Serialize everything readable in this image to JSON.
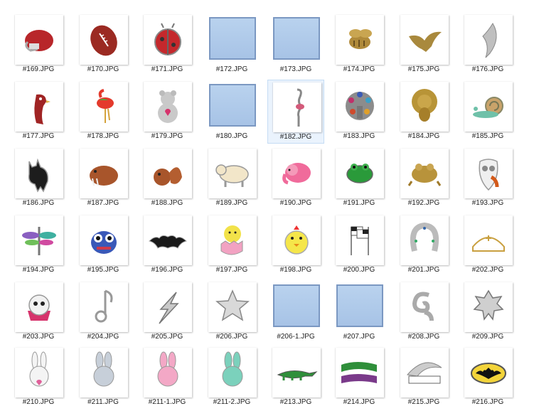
{
  "tiles": [
    {
      "label": "#169.JPG",
      "icon": "football-helmet-icon",
      "kind": "photo"
    },
    {
      "label": "#170.JPG",
      "icon": "football-icon",
      "kind": "photo"
    },
    {
      "label": "#171.JPG",
      "icon": "ladybug-icon",
      "kind": "photo"
    },
    {
      "label": "#172.JPG",
      "icon": "image-placeholder-icon",
      "kind": "placeholder"
    },
    {
      "label": "#173.JPG",
      "icon": "image-placeholder-icon",
      "kind": "placeholder"
    },
    {
      "label": "#174.JPG",
      "icon": "bee-icon",
      "kind": "photo"
    },
    {
      "label": "#175.JPG",
      "icon": "bird-icon",
      "kind": "photo"
    },
    {
      "label": "#176.JPG",
      "icon": "wing-icon",
      "kind": "photo"
    },
    {
      "label": "#177.JPG",
      "icon": "parrot-icon",
      "kind": "photo"
    },
    {
      "label": "#178.JPG",
      "icon": "flamingo-color-icon",
      "kind": "photo"
    },
    {
      "label": "#179.JPG",
      "icon": "teddy-bear-icon",
      "kind": "photo"
    },
    {
      "label": "#180.JPG",
      "icon": "image-placeholder-icon",
      "kind": "placeholder"
    },
    {
      "label": "#182.JPG",
      "icon": "flamingo-silver-icon",
      "kind": "photo",
      "selected": true
    },
    {
      "label": "#183.JPG",
      "icon": "peacock-icon",
      "kind": "photo"
    },
    {
      "label": "#184.JPG",
      "icon": "peacock-gold-icon",
      "kind": "photo"
    },
    {
      "label": "#185.JPG",
      "icon": "snail-icon",
      "kind": "photo"
    },
    {
      "label": "#186.JPG",
      "icon": "black-cat-icon",
      "kind": "photo"
    },
    {
      "label": "#187.JPG",
      "icon": "walrus-icon",
      "kind": "photo"
    },
    {
      "label": "#188.JPG",
      "icon": "squirrel-icon",
      "kind": "photo"
    },
    {
      "label": "#189.JPG",
      "icon": "polar-bear-icon",
      "kind": "photo"
    },
    {
      "label": "#190.JPG",
      "icon": "elephant-icon",
      "kind": "photo"
    },
    {
      "label": "#191.JPG",
      "icon": "green-frog-icon",
      "kind": "photo"
    },
    {
      "label": "#192.JPG",
      "icon": "gold-frog-icon",
      "kind": "photo"
    },
    {
      "label": "#193.JPG",
      "icon": "owl-icon",
      "kind": "photo"
    },
    {
      "label": "#194.JPG",
      "icon": "dragonfly-icon",
      "kind": "photo"
    },
    {
      "label": "#195.JPG",
      "icon": "owl-blue-icon",
      "kind": "photo"
    },
    {
      "label": "#196.JPG",
      "icon": "bat-icon",
      "kind": "photo"
    },
    {
      "label": "#197.JPG",
      "icon": "chick-egg-icon",
      "kind": "photo"
    },
    {
      "label": "#198.JPG",
      "icon": "chick-icon",
      "kind": "photo"
    },
    {
      "label": "#200.JPG",
      "icon": "checkered-flags-icon",
      "kind": "photo"
    },
    {
      "label": "#201.JPG",
      "icon": "horseshoe-icon",
      "kind": "photo"
    },
    {
      "label": "#202.JPG",
      "icon": "nurse-cap-icon",
      "kind": "photo"
    },
    {
      "label": "#203.JPG",
      "icon": "cupcake-skull-icon",
      "kind": "photo"
    },
    {
      "label": "#204.JPG",
      "icon": "music-note-icon",
      "kind": "photo"
    },
    {
      "label": "#205.JPG",
      "icon": "lightning-bolt-icon",
      "kind": "photo"
    },
    {
      "label": "#206.JPG",
      "icon": "star-icon",
      "kind": "photo"
    },
    {
      "label": "#206-1.JPG",
      "icon": "image-placeholder-icon",
      "kind": "placeholder"
    },
    {
      "label": "#207.JPG",
      "icon": "image-placeholder-icon",
      "kind": "placeholder"
    },
    {
      "label": "#208.JPG",
      "icon": "swirl-icon",
      "kind": "photo"
    },
    {
      "label": "#209.JPG",
      "icon": "sheriff-badge-icon",
      "kind": "photo"
    },
    {
      "label": "#210.JPG",
      "icon": "bunny-white-icon",
      "kind": "photo"
    },
    {
      "label": "#211.JPG",
      "icon": "bunny-gray-icon",
      "kind": "photo"
    },
    {
      "label": "#211-1.JPG",
      "icon": "bunny-pink-icon",
      "kind": "photo"
    },
    {
      "label": "#211-2.JPG",
      "icon": "bunny-teal-icon",
      "kind": "photo"
    },
    {
      "label": "#213.JPG",
      "icon": "alligator-icon",
      "kind": "photo"
    },
    {
      "label": "#214.JPG",
      "icon": "gator-banner-icon",
      "kind": "photo"
    },
    {
      "label": "#215.JPG",
      "icon": "bird-banner-icon",
      "kind": "photo"
    },
    {
      "label": "#216.JPG",
      "icon": "bat-emblem-icon",
      "kind": "photo"
    }
  ]
}
